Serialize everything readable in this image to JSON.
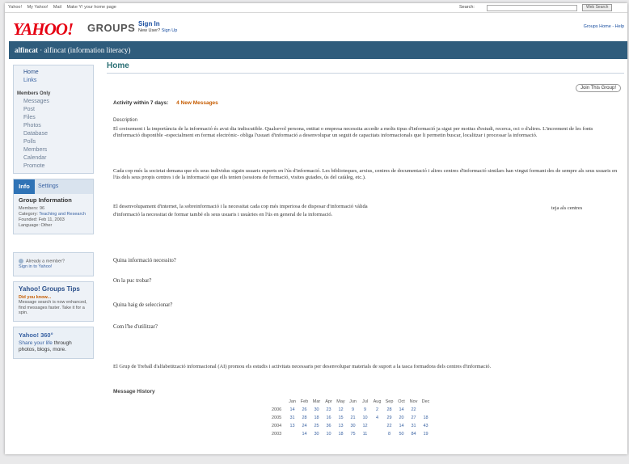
{
  "util": {
    "links": [
      "Yahoo!",
      "My Yahoo!",
      "Mail",
      "Make Y! your home page"
    ],
    "search_label": "Search:",
    "search_button": "Web Search"
  },
  "brand": {
    "logo": "YAHOO!",
    "groups": "GROUPS"
  },
  "auth": {
    "sign_in": "Sign In",
    "new_user": "New User?",
    "sign_up": "Sign Up"
  },
  "top_right_links": "Groups Home - Help",
  "group_bar": {
    "name_bold": "alfincat",
    "name_rest": " · alfincat (information literacy)"
  },
  "sidebar": {
    "nav_top": [
      "Home",
      "Links"
    ],
    "members_only_header": "Members Only",
    "members_items": [
      "Messages",
      "Post",
      "Files",
      "Photos",
      "Database",
      "Polls",
      "Members",
      "Calendar",
      "Promote"
    ],
    "tabs": {
      "info": "Info",
      "settings": "Settings"
    },
    "info": {
      "title": "Group Information",
      "members": "Members: 96",
      "category_label": "Category:",
      "category_value": "Teaching and Research",
      "founded": "Founded: Feb 11, 2003",
      "language": "Language: Other"
    },
    "member_box": {
      "already": "Already a member?",
      "signin": "Sign in to Yahoo!"
    },
    "tips": {
      "title": "Yahoo! Groups Tips",
      "subtitle": "Did you know...",
      "body": "Message search is now enhanced, find messages faster. Take it for a spin."
    },
    "y360": {
      "title": "Yahoo! 360°",
      "link": "Share your life",
      "rest": " through photos, blogs, more."
    }
  },
  "main": {
    "title": "Home",
    "join_button": "Join This Group!",
    "activity_label": "Activity within 7 days:",
    "activity_count": "4",
    "activity_suffix": "New Messages",
    "description_label": "Description",
    "paragraphs": [
      "El creixement i la importància de la informació és avui dia indiscutible. Qualsevol persona, entitat o empresa necessita accedir a molts tipus d'informació ja sigui per motius d'estudi, recerca, oci o d'altres. L'increment de les fonts d'informació disponible -especialment en format electrònic- obliga l'usuari d'informació a desenvolupar un seguit de capacitats informacionals que li permetin buscar, localitzar i processar la informació.",
      "Cada cop més la societat demana que els seus individus siguin usuaris experts en l'ús d'informació. Les biblioteques, arxius, centres de documentació i altres centres d'informació similars han vingut formant des de sempre als seus usuaris en l'ús dels seus propis centres i de la informació que ells tenien (sessions de formació, visites guiades, ús del catàleg, etc.).",
      "El desenvolupament d'internet, la sobreinformació i la necessitat cada cop més imperiosa de disposar d'informació vàlida",
      "teja als centres",
      "d'informació la necessitat de formar també els seus usuaris i usuàries en l'ús en general de la informació."
    ],
    "questions": [
      "Quina informació necessito?",
      "On la puc trobar?",
      "Quina haig de seleccionar?",
      "Com l'he d'utilitzar?"
    ],
    "closing": "El Grup de Treball d'alfabetització informacional (AI) promou els estudis i activitats necessaris per desenvolupar materials de suport a la tasca formadora dels centres d'informació.",
    "message_history": {
      "title": "Message History",
      "months": [
        "Jan",
        "Feb",
        "Mar",
        "Apr",
        "May",
        "Jun",
        "Jul",
        "Aug",
        "Sep",
        "Oct",
        "Nov",
        "Dec"
      ],
      "rows": [
        {
          "year": "2006",
          "vals": [
            "14",
            "26",
            "30",
            "23",
            "12",
            "9",
            "9",
            "2",
            "28",
            "14",
            "22",
            ""
          ]
        },
        {
          "year": "2005",
          "vals": [
            "31",
            "28",
            "18",
            "16",
            "15",
            "21",
            "10",
            "4",
            "29",
            "20",
            "27",
            "18"
          ]
        },
        {
          "year": "2004",
          "vals": [
            "13",
            "24",
            "25",
            "36",
            "13",
            "30",
            "12",
            "",
            "22",
            "14",
            "31",
            "43"
          ]
        },
        {
          "year": "2003",
          "vals": [
            "",
            "14",
            "30",
            "10",
            "18",
            "75",
            "11",
            "",
            "8",
            "50",
            "84",
            "19"
          ]
        }
      ]
    }
  }
}
